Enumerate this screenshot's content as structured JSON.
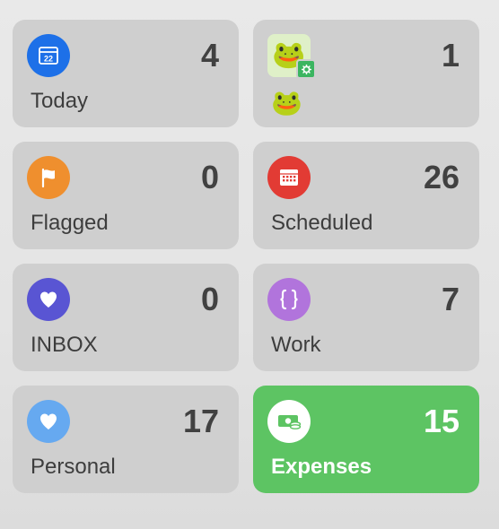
{
  "lists": [
    {
      "id": "today",
      "label": "Today",
      "count": "4",
      "icon": "calendar-22-icon",
      "icon_number": "22",
      "icon_color": "#1d70e8",
      "selected": false
    },
    {
      "id": "frog",
      "label": "",
      "count": "1",
      "icon": "frog-icon",
      "emoji": "🐸",
      "badge": "gear-icon",
      "selected": false
    },
    {
      "id": "flagged",
      "label": "Flagged",
      "count": "0",
      "icon": "flag-icon",
      "icon_color": "#ef8f2e",
      "selected": false
    },
    {
      "id": "scheduled",
      "label": "Scheduled",
      "count": "26",
      "icon": "calendar-grid-icon",
      "icon_color": "#e23b34",
      "selected": false
    },
    {
      "id": "inbox",
      "label": "INBOX",
      "count": "0",
      "icon": "heart-icon",
      "icon_color": "#5955d3",
      "selected": false
    },
    {
      "id": "work",
      "label": "Work",
      "count": "7",
      "icon": "curly-braces-icon",
      "icon_color": "#b174dc",
      "selected": false
    },
    {
      "id": "personal",
      "label": "Personal",
      "count": "17",
      "icon": "heart-icon",
      "icon_color": "#66a9f0",
      "selected": false
    },
    {
      "id": "expenses",
      "label": "Expenses",
      "count": "15",
      "icon": "money-icon",
      "icon_color": "#ffffff",
      "selected": true
    }
  ],
  "colors": {
    "tile_bg": "#cfcfcf",
    "selected_bg": "#5dc463",
    "text": "#3d3d3d"
  }
}
